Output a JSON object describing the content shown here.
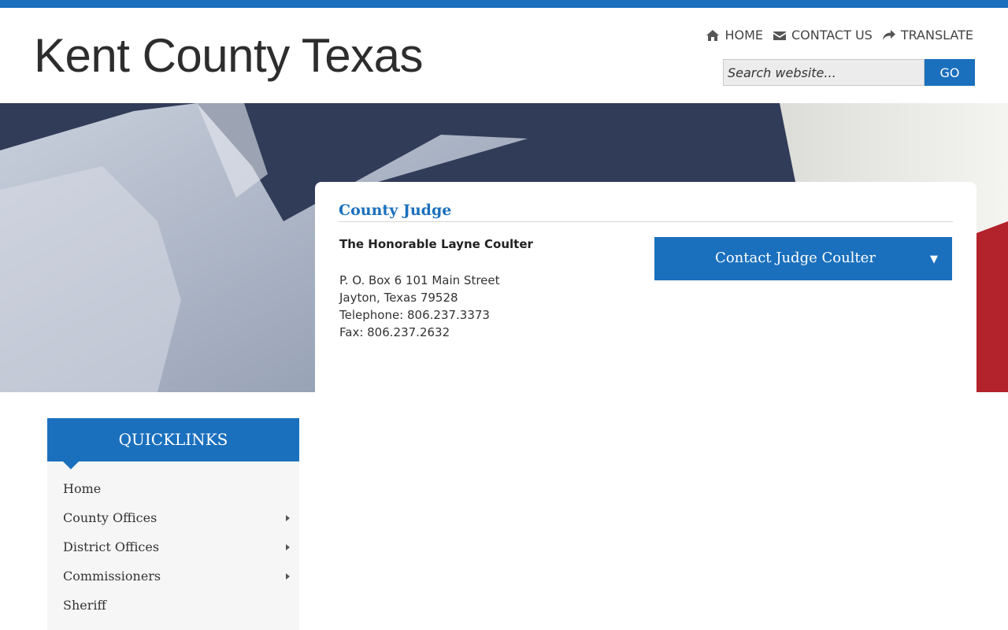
{
  "site": {
    "title": "Kent County Texas"
  },
  "util_nav": {
    "home": "HOME",
    "contact": "CONTACT US",
    "translate": "TRANSLATE"
  },
  "search": {
    "placeholder": "Search website...",
    "button": "GO"
  },
  "main": {
    "heading": "County Judge",
    "judge_name": "The Honorable Layne Coulter",
    "address_lines": [
      "P. O. Box 6 101 Main Street",
      "Jayton, Texas 79528",
      "Telephone: 806.237.3373",
      "Fax: 806.237.2632"
    ],
    "contact_button": "Contact Judge Coulter",
    "contact_caret": "▼"
  },
  "quicklinks": {
    "title": "QUICKLINKS",
    "items": [
      {
        "label": "Home",
        "submenu": false
      },
      {
        "label": "County Offices",
        "submenu": true
      },
      {
        "label": "District Offices",
        "submenu": true
      },
      {
        "label": "Commissioners",
        "submenu": true
      },
      {
        "label": "Sheriff",
        "submenu": false
      }
    ]
  },
  "colors": {
    "accent": "#1b70bd",
    "text": "#333333",
    "sidebar_bg": "#f6f6f6"
  },
  "icons": {
    "home": "home-icon",
    "contact": "envelope-icon",
    "translate": "share-arrow-icon"
  }
}
